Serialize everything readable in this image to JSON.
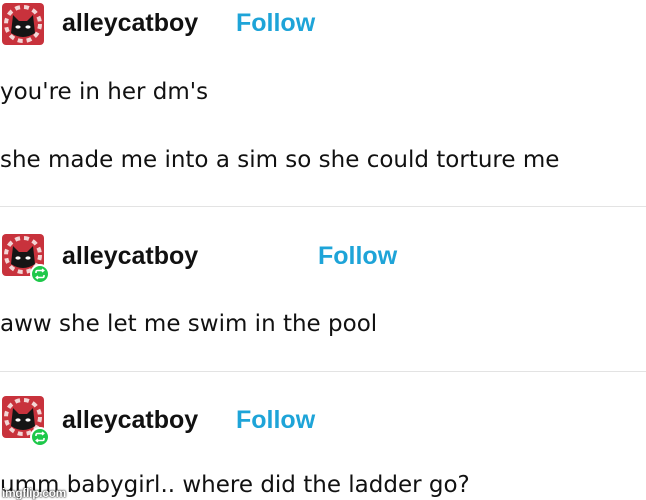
{
  "posts": [
    {
      "username": "alleycatboy",
      "follow_label": "Follow",
      "paragraphs": [
        "you're in her dm's",
        "she made me into a sim so she could torture me"
      ]
    },
    {
      "username": "alleycatboy",
      "follow_label": "Follow",
      "paragraphs": [
        "aww she let me swim in the pool"
      ]
    },
    {
      "username": "alleycatboy",
      "follow_label": "Follow",
      "paragraphs": [
        "umm babygirl.. where did the ladder go?"
      ]
    }
  ],
  "watermark": "imgflip.com",
  "colors": {
    "follow": "#1ea4d8",
    "reblog_badge": "#1ec84a",
    "avatar_bg": "#c8323c",
    "divider": "#e3e3e3"
  },
  "icons": {
    "avatar": "cat-avatar-icon",
    "reblog": "reblog-icon"
  }
}
